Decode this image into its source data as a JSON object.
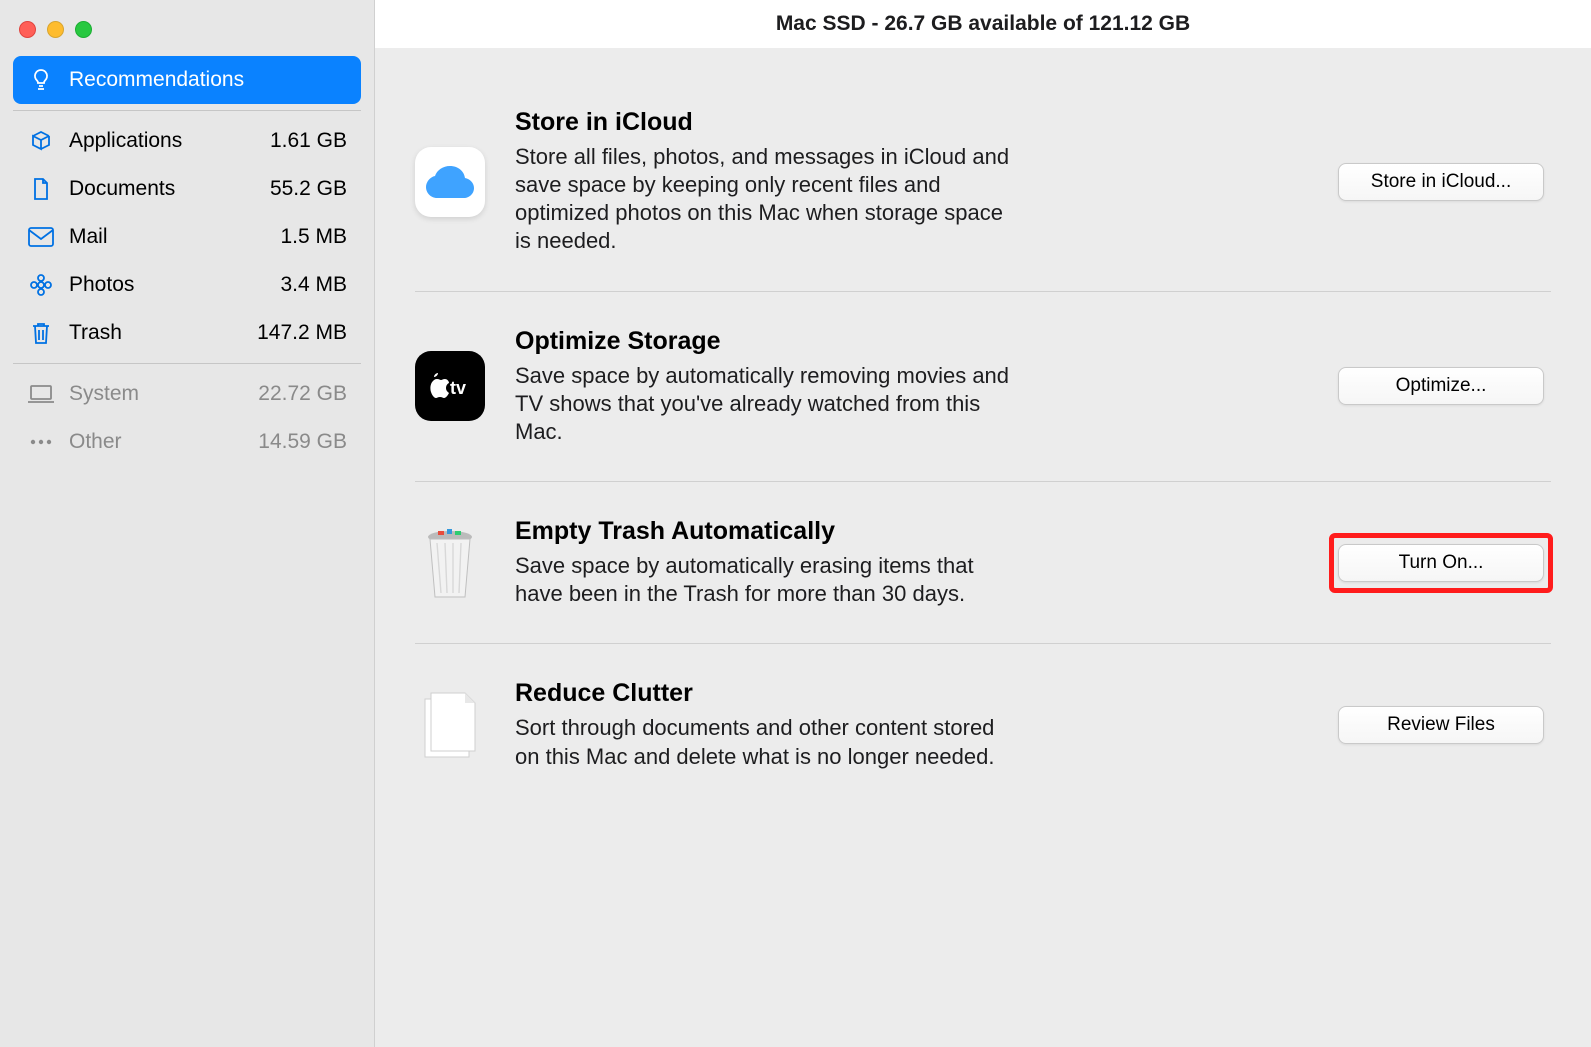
{
  "titlebar": "Mac SSD - 26.7 GB available of 121.12 GB",
  "sidebar": {
    "groups": [
      {
        "items": [
          {
            "label": "Recommendations",
            "size": "",
            "icon": "lightbulb",
            "selected": true
          }
        ]
      },
      {
        "items": [
          {
            "label": "Applications",
            "size": "1.61 GB",
            "icon": "apps"
          },
          {
            "label": "Documents",
            "size": "55.2 GB",
            "icon": "doc"
          },
          {
            "label": "Mail",
            "size": "1.5 MB",
            "icon": "mail"
          },
          {
            "label": "Photos",
            "size": "3.4 MB",
            "icon": "flower"
          },
          {
            "label": "Trash",
            "size": "147.2 MB",
            "icon": "trash"
          }
        ]
      },
      {
        "items": [
          {
            "label": "System",
            "size": "22.72 GB",
            "icon": "laptop",
            "dim": true
          },
          {
            "label": "Other",
            "size": "14.59 GB",
            "icon": "dots",
            "dim": true
          }
        ]
      }
    ]
  },
  "recommendations": [
    {
      "title": "Store in iCloud",
      "desc": "Store all files, photos, and messages in iCloud and save space by keeping only recent files and optimized photos on this Mac when storage space is needed.",
      "button": "Store in iCloud...",
      "icon": "icloud"
    },
    {
      "title": "Optimize Storage",
      "desc": "Save space by automatically removing movies and TV shows that you've already watched from this Mac.",
      "button": "Optimize...",
      "icon": "appletv"
    },
    {
      "title": "Empty Trash Automatically",
      "desc": "Save space by automatically erasing items that have been in the Trash for more than 30 days.",
      "button": "Turn On...",
      "icon": "trashfull",
      "highlight": true
    },
    {
      "title": "Reduce Clutter",
      "desc": "Sort through documents and other content stored on this Mac and delete what is no longer needed.",
      "button": "Review Files",
      "icon": "docstack"
    }
  ]
}
